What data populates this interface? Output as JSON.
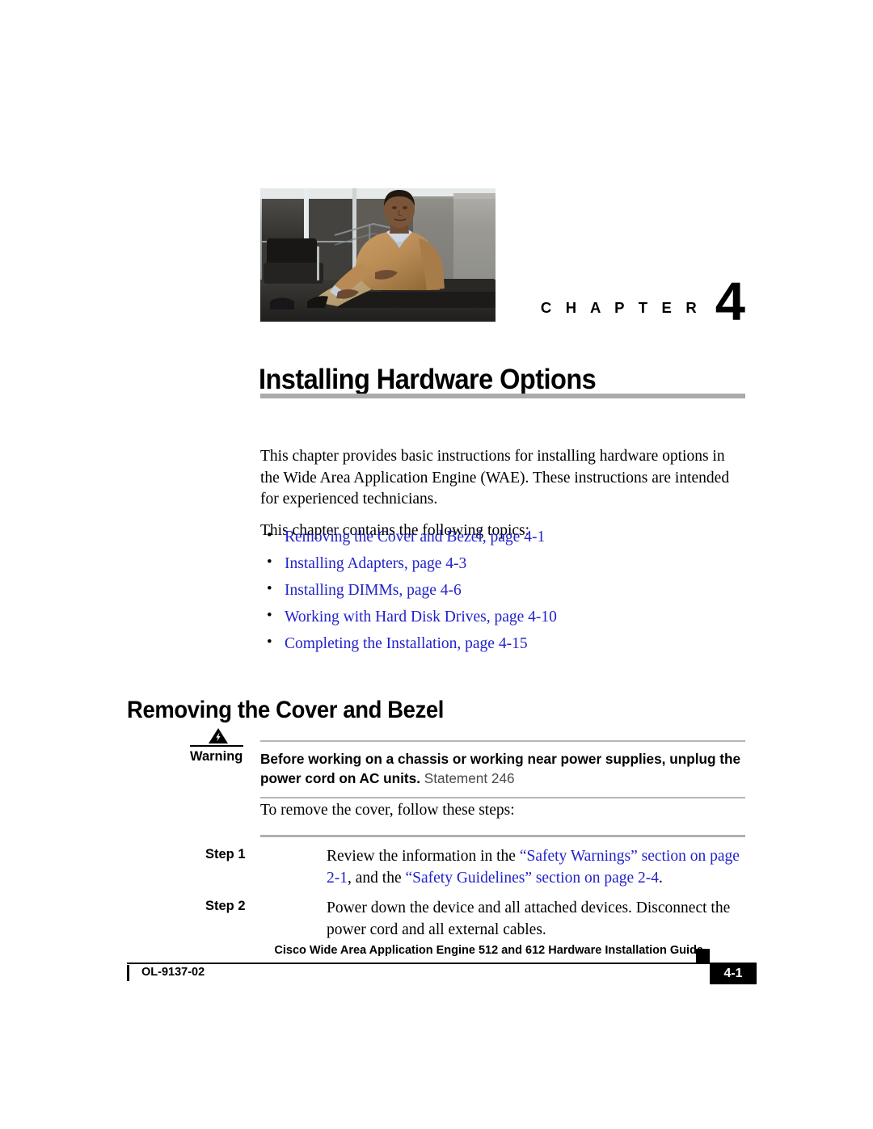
{
  "chapter": {
    "word": "C H A P T E R",
    "number": "4",
    "title": "Installing Hardware Options",
    "photo_alt": "seated-man-photo"
  },
  "intro": {
    "paragraph_1": "This chapter provides basic instructions for installing hardware options in the Wide Area Application Engine (WAE). These instructions are intended for experienced technicians.",
    "paragraph_2": "This chapter contains the following topics:",
    "bullet": "•"
  },
  "topics": [
    {
      "label": "Removing the Cover and Bezel, page 4-1"
    },
    {
      "label": "Installing Adapters, page 4-3"
    },
    {
      "label": "Installing DIMMs, page 4-6"
    },
    {
      "label": "Working with Hard Disk Drives, page 4-10"
    },
    {
      "label": "Completing the Installation, page 4-15"
    }
  ],
  "section": {
    "heading": "Removing the Cover and Bezel"
  },
  "warning": {
    "label": "Warning",
    "icon": "warning-lightning-triangle-icon",
    "bold_text": "Before working on a chassis or working near power supplies, unplug the power cord on AC units.",
    "statement": "Statement 246"
  },
  "procedure": {
    "lead_in": "To remove the cover, follow these steps:",
    "steps": [
      {
        "label": "Step 1",
        "text_before": "Review the information in the ",
        "link_1": "“Safety Warnings” section on page 2-1",
        "text_middle": ", and the ",
        "link_2": "“Safety Guidelines” section on page 2-4",
        "text_after": "."
      },
      {
        "label": "Step 2",
        "text_before": "Power down the device and all attached devices. Disconnect the power cord and all external cables.",
        "link_1": "",
        "text_middle": "",
        "link_2": "",
        "text_after": ""
      }
    ]
  },
  "footer": {
    "guide_title": "Cisco Wide Area Application Engine 512 and 612 Hardware Installation Guide",
    "doc_id": "OL-9137-02",
    "page_number": "4-1"
  },
  "colors": {
    "link": "#2222cc",
    "rule_gray": "#aaaaaa",
    "warning_rule": "#b5b5b5",
    "text": "#000000"
  }
}
